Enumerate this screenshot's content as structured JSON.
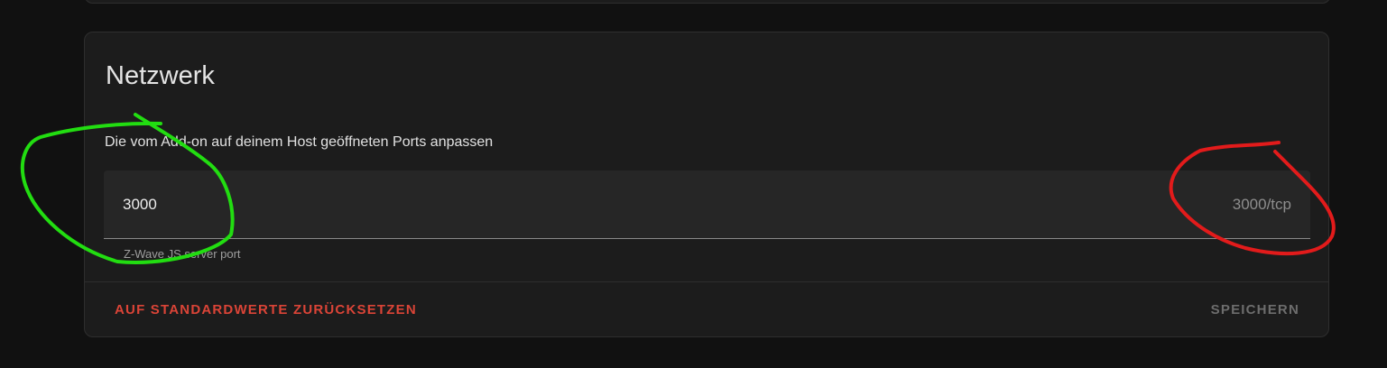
{
  "section": {
    "title": "Netzwerk",
    "description": "Die vom Add-on auf deinem Host geöffneten Ports anpassen"
  },
  "port_field": {
    "value": "3000",
    "suffix": "3000/tcp",
    "helper": "Z-Wave JS server port"
  },
  "actions": {
    "reset_label": "AUF STANDARDWERTE ZURÜCKSETZEN",
    "save_label": "SPEICHERN"
  },
  "colors": {
    "background": "#111111",
    "card": "#1c1c1c",
    "accent_reset": "#db4437",
    "annotation_green": "#22dd11",
    "annotation_red": "#e21b1b"
  }
}
